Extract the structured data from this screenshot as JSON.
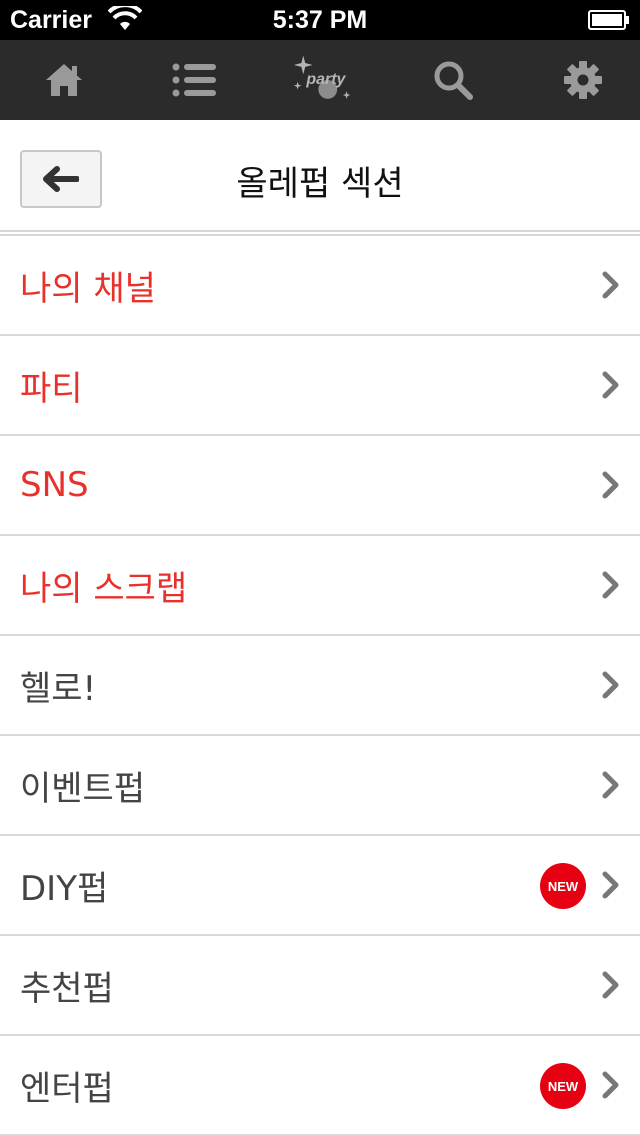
{
  "status_bar": {
    "carrier": "Carrier",
    "time": "5:37 PM"
  },
  "toolbar": {
    "items": [
      {
        "icon": "home-icon"
      },
      {
        "icon": "list-icon"
      },
      {
        "icon": "party-logo-icon",
        "text": "party"
      },
      {
        "icon": "search-icon"
      },
      {
        "icon": "gear-icon"
      }
    ]
  },
  "header": {
    "title": "올레펍 섹션"
  },
  "menu": {
    "items": [
      {
        "label": "나의 채널",
        "color": "#e8312a"
      },
      {
        "label": "파티",
        "color": "#e8312a"
      },
      {
        "label": "SNS",
        "color": "#e8312a"
      },
      {
        "label": "나의 스크랩",
        "color": "#e8312a"
      },
      {
        "label": "헬로!",
        "color": "#444444"
      },
      {
        "label": "이벤트펍",
        "color": "#444444"
      },
      {
        "label": "DIY펍",
        "color": "#444444",
        "badge": "NEW"
      },
      {
        "label": "추천펍",
        "color": "#444444"
      },
      {
        "label": "엔터펍",
        "color": "#444444",
        "badge": "NEW"
      }
    ]
  }
}
